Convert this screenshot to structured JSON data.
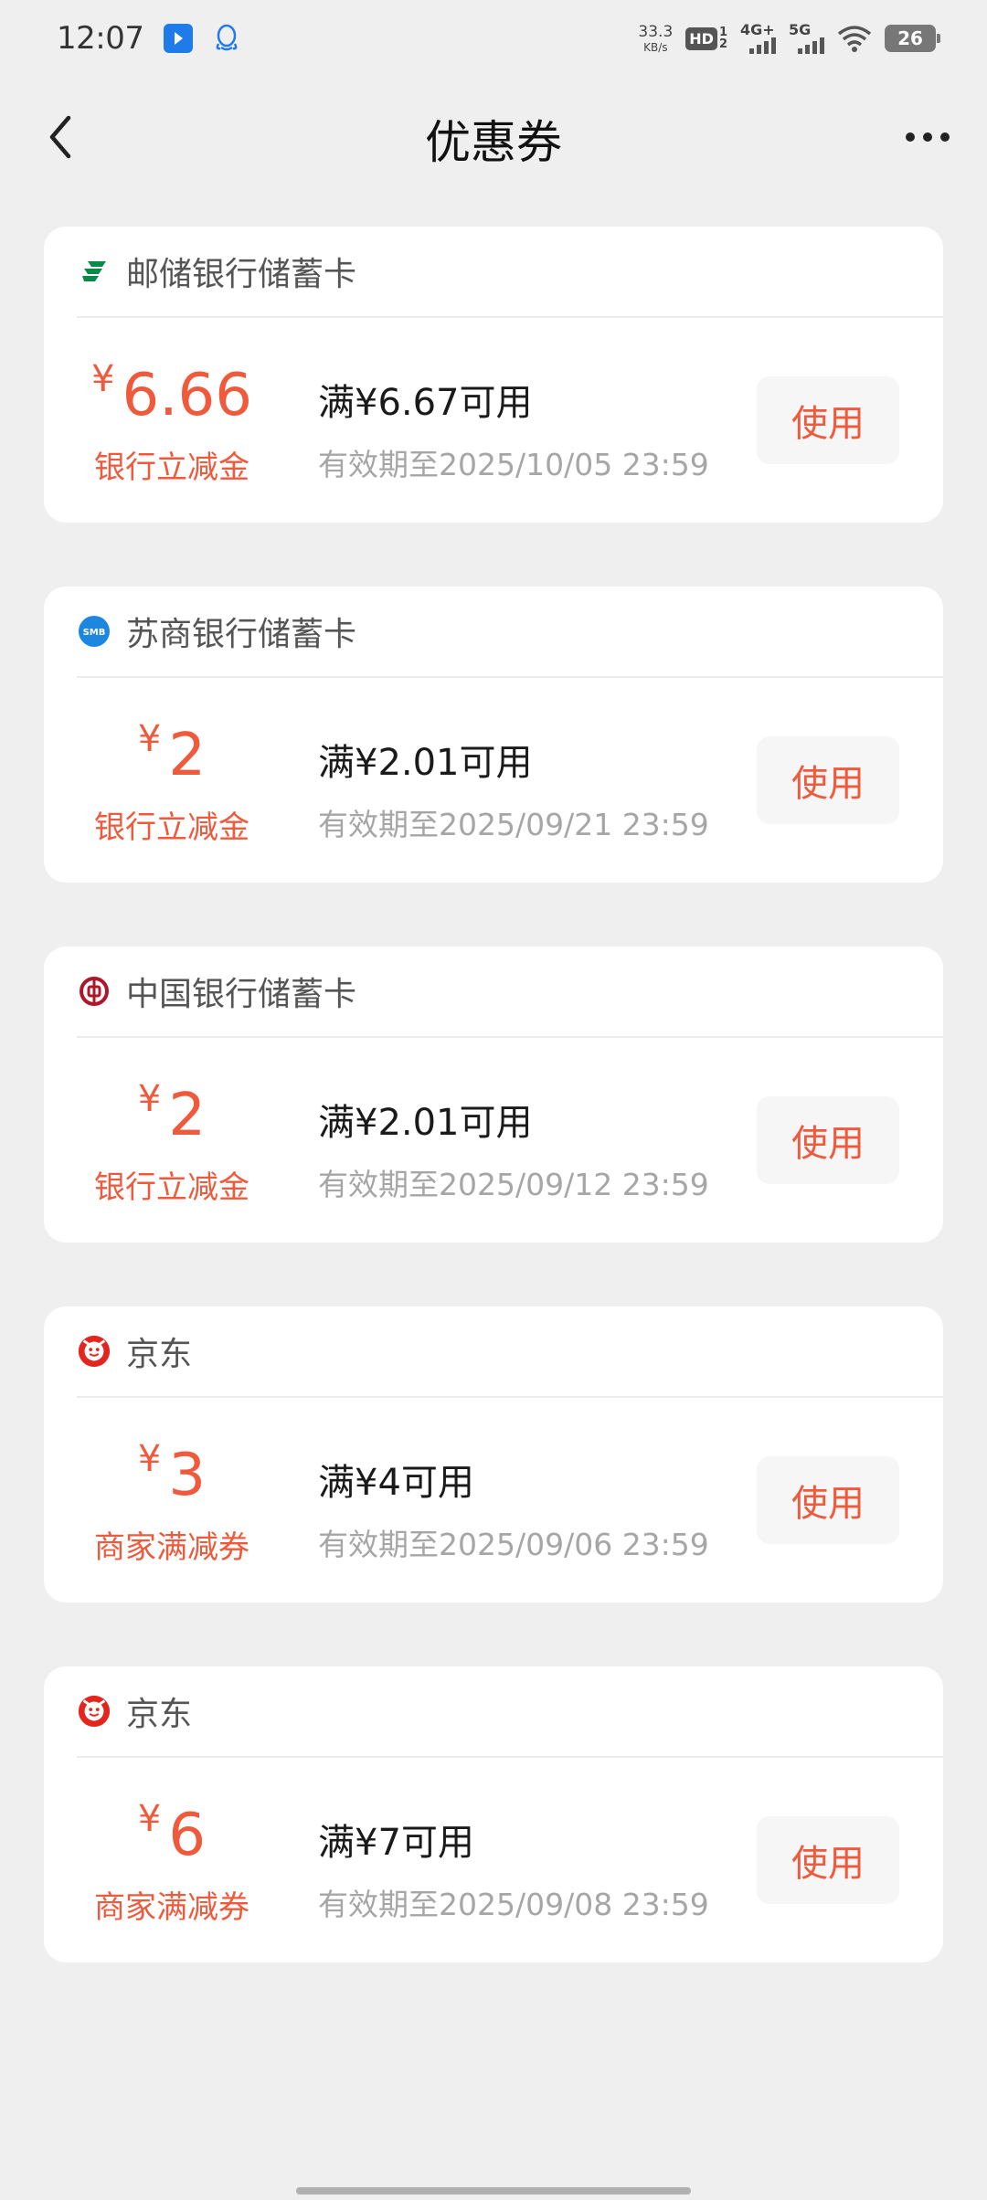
{
  "status_bar": {
    "time": "12:07",
    "net_speed_value": "33.3",
    "net_speed_unit": "KB/s",
    "hd_label": "HD",
    "hd_sub_top": "1",
    "hd_sub_bottom": "2",
    "network_1": "4G+",
    "network_2": "5G",
    "battery": "26"
  },
  "nav": {
    "title": "优惠券"
  },
  "coupons": [
    {
      "bank": "邮储银行储蓄卡",
      "logo": "postal-savings-bank-icon",
      "currency": "¥",
      "amount": "6.66",
      "type": "银行立减金",
      "condition": "满¥6.67可用",
      "validity": "有效期至2025/10/05  23:59",
      "button": "使用"
    },
    {
      "bank": "苏商银行储蓄卡",
      "logo": "suzhou-bank-icon",
      "currency": "¥",
      "amount": "2",
      "type": "银行立减金",
      "condition": "满¥2.01可用",
      "validity": "有效期至2025/09/21  23:59",
      "button": "使用"
    },
    {
      "bank": "中国银行储蓄卡",
      "logo": "bank-of-china-icon",
      "currency": "¥",
      "amount": "2",
      "type": "银行立减金",
      "condition": "满¥2.01可用",
      "validity": "有效期至2025/09/12  23:59",
      "button": "使用"
    },
    {
      "bank": "京东",
      "logo": "jd-icon",
      "currency": "¥",
      "amount": "3",
      "type": "商家满减券",
      "condition": "满¥4可用",
      "validity": "有效期至2025/09/06  23:59",
      "button": "使用"
    },
    {
      "bank": "京东",
      "logo": "jd-icon",
      "currency": "¥",
      "amount": "6",
      "type": "商家满减券",
      "condition": "满¥7可用",
      "validity": "有效期至2025/09/08  23:59",
      "button": "使用"
    }
  ],
  "colors": {
    "accent": "#ef5a3c",
    "background": "#efefef",
    "card": "#ffffff"
  }
}
